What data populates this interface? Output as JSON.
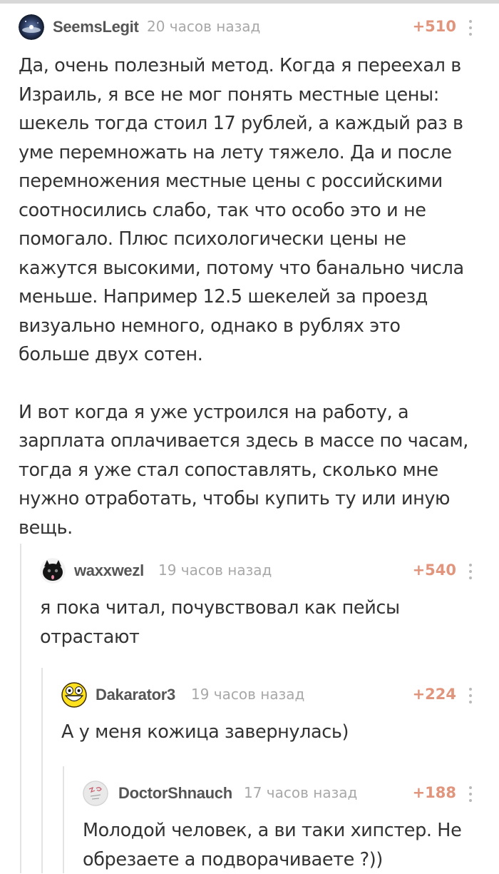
{
  "comments": [
    {
      "author": "SeemsLegit",
      "time": "20 часов назад",
      "rating": "+510",
      "avatar_icon": "galaxy-avatar-icon",
      "paragraphs": [
        [
          "Да, очень полезный метод. Когда я переехал в",
          "Израиль, я все не мог понять местные цены:",
          "шекель тогда стоил 17 рублей, а каждый раз в",
          "уме перемножать на лету тяжело. Да и после",
          "перемножения местные цены  с российскими",
          "соотносились слабо, так что особо это и не",
          "помогало. Плюс психологически цены не",
          "кажутся высокими, потому что банально числа",
          "меньше. Например 12.5 шекелей за проезд",
          "визуально немного, однако в рублях это",
          "больше двух сотен."
        ],
        [
          "И вот когда я уже устроился на работу, а",
          "зарплата оплачивается здесь в массе по часам,",
          "тогда я уже стал сопоставлять, сколько мне",
          "нужно отработать, чтобы купить ту или иную",
          "вещь."
        ]
      ]
    },
    {
      "author": "waxxwezl",
      "time": "19 часов назад",
      "rating": "+540",
      "avatar_icon": "black-cat-avatar-icon",
      "paragraphs": [
        [
          "я пока читал, почувствовал как пейсы",
          "отрастают"
        ]
      ]
    },
    {
      "author": "Dakarator3",
      "time": "19 часов назад",
      "rating": "+224",
      "avatar_icon": "epic-smiley-avatar-icon",
      "paragraphs": [
        [
          "А у меня кожица завернулась)"
        ]
      ]
    },
    {
      "author": "DoctorShnauch",
      "time": "17 часов назад",
      "rating": "+188",
      "avatar_icon": "sketch-avatar-icon",
      "paragraphs": [
        [
          "Молодой человек, а ви таки хипстер. Не",
          "обрезаете а подворачиваете ?))"
        ]
      ]
    }
  ],
  "colors": {
    "author": "#555555",
    "time": "#a8a8a8",
    "rating": "#e0957c",
    "body_text": "#333333",
    "thread_line": "#e3e3e3",
    "top_rule": "#d8d8d8"
  }
}
